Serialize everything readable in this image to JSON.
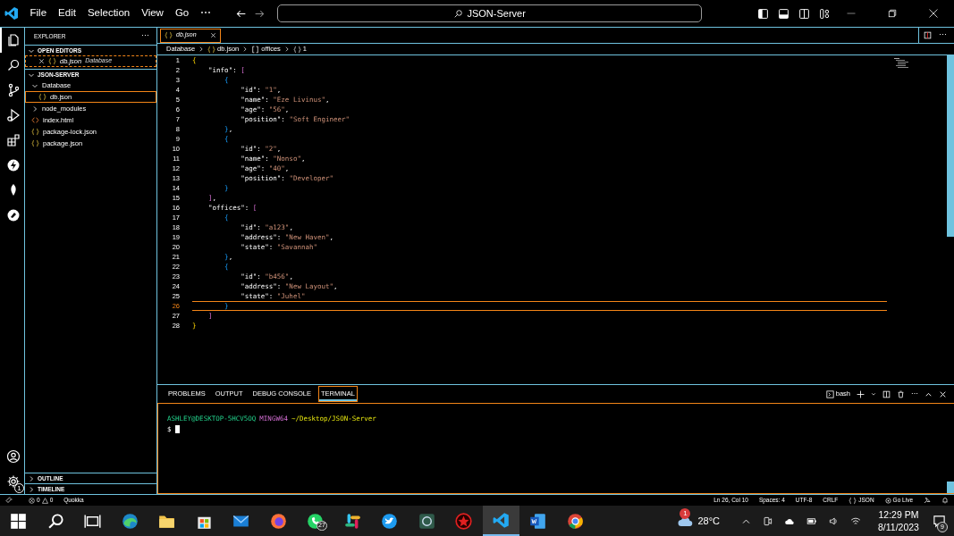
{
  "title_bar": {
    "menus": [
      "File",
      "Edit",
      "Selection",
      "View",
      "Go",
      "⋯"
    ],
    "search": {
      "value": "JSON-Server"
    }
  },
  "activity_bar": {
    "top": [
      {
        "kind": "files",
        "selected": true
      },
      {
        "kind": "search",
        "selected": false
      },
      {
        "kind": "branch",
        "selected": false
      },
      {
        "kind": "run",
        "selected": false
      },
      {
        "kind": "extensions",
        "selected": false
      },
      {
        "kind": "lightning",
        "selected": false
      },
      {
        "kind": "leaf",
        "selected": false
      },
      {
        "kind": "gauge",
        "selected": false
      }
    ],
    "bottom": [
      {
        "kind": "account"
      },
      {
        "kind": "settings",
        "badge": "1"
      }
    ]
  },
  "sidebar": {
    "title": "EXPLORER",
    "more": "⋯",
    "open_editors": {
      "label": "OPEN EDITORS",
      "expanded": true,
      "items": [
        {
          "name": "db.json",
          "folder": "Database",
          "kind": "json",
          "preview": true
        }
      ]
    },
    "folder": {
      "label": "JSON-SERVER",
      "expanded": true,
      "items": [
        {
          "name": "Database",
          "kind": "folder",
          "expanded": true,
          "selected": false,
          "children": [
            {
              "name": "db.json",
              "kind": "json",
              "selected": true
            }
          ]
        },
        {
          "name": "node_modules",
          "kind": "folder",
          "expanded": false,
          "selected": false
        },
        {
          "name": "index.html",
          "kind": "html",
          "selected": false
        },
        {
          "name": "package-lock.json",
          "kind": "json",
          "selected": false
        },
        {
          "name": "package.json",
          "kind": "json",
          "selected": false
        }
      ]
    },
    "sections": [
      {
        "label": "OUTLINE",
        "expanded": false
      },
      {
        "label": "TIMELINE",
        "expanded": false
      }
    ]
  },
  "editor": {
    "tabs": [
      {
        "name": "db.json",
        "kind": "json",
        "preview": true,
        "selected": true
      }
    ],
    "breadcrumbs": [
      {
        "text": "Database",
        "kind": "folder"
      },
      {
        "text": "db.json",
        "kind": "json"
      },
      {
        "text": "offices",
        "kind": "array"
      },
      {
        "text": "1",
        "kind": "object"
      }
    ],
    "lines": [
      {
        "number": "1",
        "current": false,
        "tokens": [
          {
            "kind": "b1",
            "text": "{"
          }
        ]
      },
      {
        "number": "2",
        "current": false,
        "tokens": [
          {
            "kind": "key",
            "text": "    \"info\""
          },
          {
            "kind": "p",
            "text": ": "
          },
          {
            "kind": "b2",
            "text": "["
          }
        ]
      },
      {
        "number": "3",
        "current": false,
        "tokens": [
          {
            "kind": "b3",
            "text": "        {"
          }
        ]
      },
      {
        "number": "4",
        "current": false,
        "tokens": [
          {
            "kind": "key",
            "text": "            \"id\""
          },
          {
            "kind": "p",
            "text": ": "
          },
          {
            "kind": "str",
            "text": "\"1\""
          },
          {
            "kind": "p",
            "text": ","
          }
        ]
      },
      {
        "number": "5",
        "current": false,
        "tokens": [
          {
            "kind": "key",
            "text": "            \"name\""
          },
          {
            "kind": "p",
            "text": ": "
          },
          {
            "kind": "str",
            "text": "\"Eze Livinus\""
          },
          {
            "kind": "p",
            "text": ","
          }
        ]
      },
      {
        "number": "6",
        "current": false,
        "tokens": [
          {
            "kind": "key",
            "text": "            \"age\""
          },
          {
            "kind": "p",
            "text": ": "
          },
          {
            "kind": "str",
            "text": "\"56\""
          },
          {
            "kind": "p",
            "text": ","
          }
        ]
      },
      {
        "number": "7",
        "current": false,
        "tokens": [
          {
            "kind": "key",
            "text": "            \"position\""
          },
          {
            "kind": "p",
            "text": ": "
          },
          {
            "kind": "str",
            "text": "\"Soft Engineer\""
          }
        ]
      },
      {
        "number": "8",
        "current": false,
        "tokens": [
          {
            "kind": "b3",
            "text": "        }"
          },
          {
            "kind": "p",
            "text": ","
          }
        ]
      },
      {
        "number": "9",
        "current": false,
        "tokens": [
          {
            "kind": "b3",
            "text": "        {"
          }
        ]
      },
      {
        "number": "10",
        "current": false,
        "tokens": [
          {
            "kind": "key",
            "text": "            \"id\""
          },
          {
            "kind": "p",
            "text": ": "
          },
          {
            "kind": "str",
            "text": "\"2\""
          },
          {
            "kind": "p",
            "text": ","
          }
        ]
      },
      {
        "number": "11",
        "current": false,
        "tokens": [
          {
            "kind": "key",
            "text": "            \"name\""
          },
          {
            "kind": "p",
            "text": ": "
          },
          {
            "kind": "str",
            "text": "\"Nonso\""
          },
          {
            "kind": "p",
            "text": ","
          }
        ]
      },
      {
        "number": "12",
        "current": false,
        "tokens": [
          {
            "kind": "key",
            "text": "            \"age\""
          },
          {
            "kind": "p",
            "text": ": "
          },
          {
            "kind": "str",
            "text": "\"40\""
          },
          {
            "kind": "p",
            "text": ","
          }
        ]
      },
      {
        "number": "13",
        "current": false,
        "tokens": [
          {
            "kind": "key",
            "text": "            \"position\""
          },
          {
            "kind": "p",
            "text": ": "
          },
          {
            "kind": "str",
            "text": "\"Developer\""
          }
        ]
      },
      {
        "number": "14",
        "current": false,
        "tokens": [
          {
            "kind": "b3",
            "text": "        }"
          }
        ]
      },
      {
        "number": "15",
        "current": false,
        "tokens": [
          {
            "kind": "b2",
            "text": "    ]"
          },
          {
            "kind": "p",
            "text": ","
          }
        ]
      },
      {
        "number": "16",
        "current": false,
        "tokens": [
          {
            "kind": "key",
            "text": "    \"offices\""
          },
          {
            "kind": "p",
            "text": ": "
          },
          {
            "kind": "b2",
            "text": "["
          }
        ]
      },
      {
        "number": "17",
        "current": false,
        "tokens": [
          {
            "kind": "b3",
            "text": "        {"
          }
        ]
      },
      {
        "number": "18",
        "current": false,
        "tokens": [
          {
            "kind": "key",
            "text": "            \"id\""
          },
          {
            "kind": "p",
            "text": ": "
          },
          {
            "kind": "str",
            "text": "\"a123\""
          },
          {
            "kind": "p",
            "text": ","
          }
        ]
      },
      {
        "number": "19",
        "current": false,
        "tokens": [
          {
            "kind": "key",
            "text": "            \"address\""
          },
          {
            "kind": "p",
            "text": ": "
          },
          {
            "kind": "str",
            "text": "\"New Haven\""
          },
          {
            "kind": "p",
            "text": ","
          }
        ]
      },
      {
        "number": "20",
        "current": false,
        "tokens": [
          {
            "kind": "key",
            "text": "            \"state\""
          },
          {
            "kind": "p",
            "text": ": "
          },
          {
            "kind": "str",
            "text": "\"Savannah\""
          }
        ]
      },
      {
        "number": "21",
        "current": false,
        "tokens": [
          {
            "kind": "b3",
            "text": "        }"
          },
          {
            "kind": "p",
            "text": ","
          }
        ]
      },
      {
        "number": "22",
        "current": false,
        "tokens": [
          {
            "kind": "b3",
            "text": "        {"
          }
        ]
      },
      {
        "number": "23",
        "current": false,
        "tokens": [
          {
            "kind": "key",
            "text": "            \"id\""
          },
          {
            "kind": "p",
            "text": ": "
          },
          {
            "kind": "str",
            "text": "\"b456\""
          },
          {
            "kind": "p",
            "text": ","
          }
        ]
      },
      {
        "number": "24",
        "current": false,
        "tokens": [
          {
            "kind": "key",
            "text": "            \"address\""
          },
          {
            "kind": "p",
            "text": ": "
          },
          {
            "kind": "str",
            "text": "\"New Layout\""
          },
          {
            "kind": "p",
            "text": ","
          }
        ]
      },
      {
        "number": "25",
        "current": false,
        "tokens": [
          {
            "kind": "key",
            "text": "            \"state\""
          },
          {
            "kind": "p",
            "text": ": "
          },
          {
            "kind": "str",
            "text": "\"Juhel\""
          }
        ]
      },
      {
        "number": "26",
        "current": true,
        "tokens": [
          {
            "kind": "b3",
            "text": "        }"
          }
        ]
      },
      {
        "number": "27",
        "current": false,
        "tokens": [
          {
            "kind": "b2",
            "text": "    ]"
          }
        ]
      },
      {
        "number": "28",
        "current": false,
        "tokens": [
          {
            "kind": "b1",
            "text": "}"
          }
        ]
      }
    ]
  },
  "panel": {
    "tabs": [
      {
        "label": "PROBLEMS",
        "selected": false
      },
      {
        "label": "OUTPUT",
        "selected": false
      },
      {
        "label": "DEBUG CONSOLE",
        "selected": false
      },
      {
        "label": "TERMINAL",
        "selected": true
      }
    ],
    "shell": "bash",
    "terminal": {
      "user": "ASHLEY@DESKTOP-5HCV5OQ",
      "system": "MINGW64",
      "path": "~/Desktop/JSON-Server",
      "prompt": "$"
    }
  },
  "status_bar": {
    "errors": "0",
    "warnings": "0",
    "left_items": [
      "Quokka"
    ],
    "right_items": [
      "Ln 26, Col 10",
      "Spaces: 4",
      "UTF-8",
      "CRLF"
    ],
    "language": "JSON",
    "go_live": "Go Live"
  },
  "taskbar": {
    "apps": [
      {
        "kind": "windows",
        "active": false
      },
      {
        "kind": "search",
        "active": false
      },
      {
        "kind": "taskview",
        "active": false
      },
      {
        "kind": "edge",
        "active": false
      },
      {
        "kind": "folder",
        "active": false
      },
      {
        "kind": "store",
        "active": false
      },
      {
        "kind": "mail",
        "active": false
      },
      {
        "kind": "firefox",
        "active": false
      },
      {
        "kind": "whatsapp",
        "active": false,
        "badge": "27"
      },
      {
        "kind": "slack",
        "active": false
      },
      {
        "kind": "bird",
        "active": false
      },
      {
        "kind": "grid",
        "active": false
      },
      {
        "kind": "star",
        "active": false
      },
      {
        "kind": "code",
        "active": true
      },
      {
        "kind": "document",
        "active": false
      },
      {
        "kind": "chrome",
        "active": false
      }
    ],
    "weather": {
      "temperature": "28°C",
      "badge": "1"
    },
    "time": "12:29 PM",
    "date": "8/11/2023",
    "notifications": "9"
  }
}
